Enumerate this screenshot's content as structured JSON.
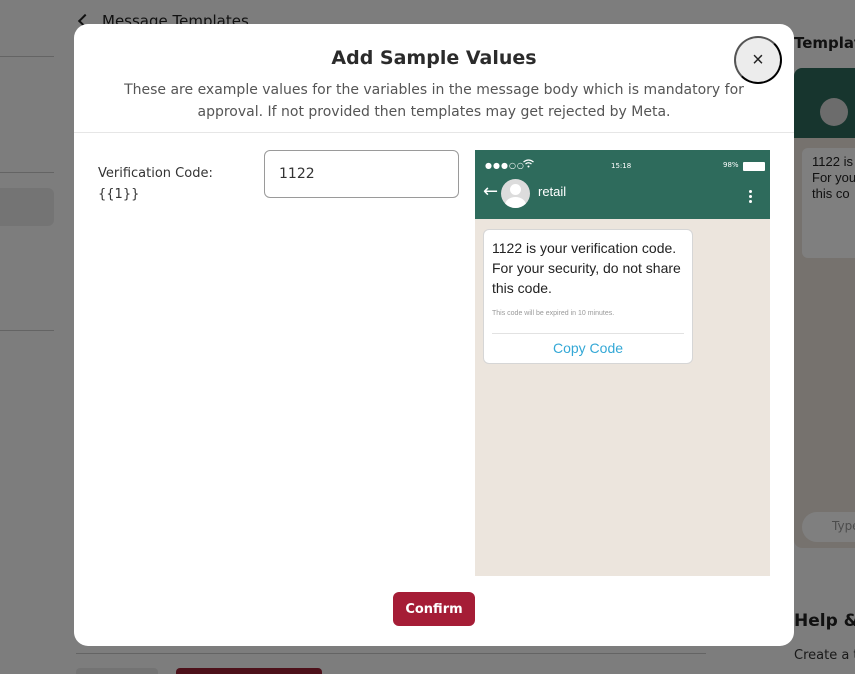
{
  "background": {
    "header_title": "Message Templates",
    "right_panel_title": "Templates",
    "preview_bubble_text": "1122 is\nFor you\nthis co",
    "input_placeholder": "Type",
    "help_title": "Help &",
    "help_text": "Create a te"
  },
  "modal": {
    "title": "Add Sample Values",
    "subtitle": "These are example values for the variables in the message body which is mandatory for approval. If not provided then templates may get rejected by Meta.",
    "close_label": "×",
    "variable": {
      "label": "Verification Code:",
      "placeholder": "{{1}}",
      "value": "1122"
    },
    "confirm_label": "Confirm"
  },
  "preview": {
    "status": {
      "signal": "●●●○○",
      "time": "15:18",
      "battery": "98%"
    },
    "contact_name": "retail",
    "message_body": "1122 is your verification code. For your security, do not share this code.",
    "footer": "This code will be expired in 10 minutes.",
    "button_label": "Copy Code"
  },
  "colors": {
    "header_green": "#2e6b5c",
    "chat_background": "#ece5dd",
    "confirm_button": "#a51d36",
    "link_blue": "#34a8d6",
    "overlay": "rgba(0,0,0,0.5)"
  }
}
